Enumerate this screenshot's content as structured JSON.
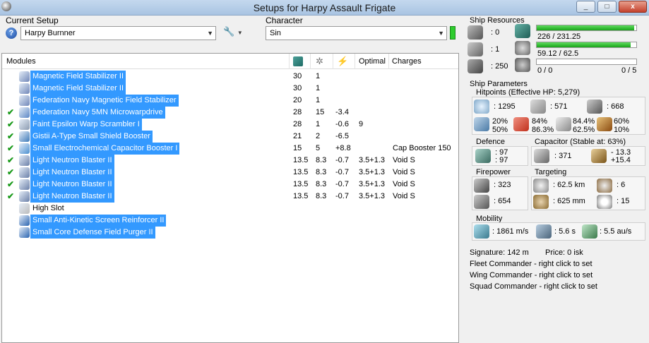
{
  "window": {
    "title": "Setups for Harpy Assault Frigate",
    "min": "_",
    "max": "□",
    "close": "x"
  },
  "setup": {
    "label": "Current Setup",
    "value": "Harpy Burnner",
    "help": "?"
  },
  "character": {
    "label": "Character",
    "value": "Sin"
  },
  "modules": {
    "headers": {
      "name": "Modules",
      "optimal": "Optimal",
      "charges": "Charges"
    },
    "rows": [
      {
        "check": "",
        "name": "Magnetic Field Stabilizer II",
        "cpu": "30",
        "pg": "1",
        "cap": "",
        "optimal": "",
        "charge": "",
        "sel": true,
        "icon": "#6f86b8"
      },
      {
        "check": "",
        "name": "Magnetic Field Stabilizer II",
        "cpu": "30",
        "pg": "1",
        "cap": "",
        "optimal": "",
        "charge": "",
        "sel": true,
        "icon": "#6f86b8"
      },
      {
        "check": "",
        "name": "Federation Navy Magnetic Field Stabilizer",
        "cpu": "20",
        "pg": "1",
        "cap": "",
        "optimal": "",
        "charge": "",
        "sel": true,
        "icon": "#6f86b8"
      },
      {
        "check": "✔",
        "name": "Federation Navy 5MN Microwarpdrive",
        "cpu": "28",
        "pg": "15",
        "cap": "-3.4",
        "optimal": "",
        "charge": "",
        "sel": true,
        "icon": "#5b86c4"
      },
      {
        "check": "✔",
        "name": "Faint Epsilon Warp Scrambler I",
        "cpu": "28",
        "pg": "1",
        "cap": "-0.6",
        "optimal": "9",
        "charge": "",
        "sel": true,
        "icon": "#8a9ab0"
      },
      {
        "check": "✔",
        "name": "Gistii A-Type Small Shield Booster",
        "cpu": "21",
        "pg": "2",
        "cap": "-6.5",
        "optimal": "",
        "charge": "",
        "sel": true,
        "icon": "#3d7ab8"
      },
      {
        "check": "✔",
        "name": "Small Electrochemical Capacitor Booster I",
        "cpu": "15",
        "pg": "5",
        "cap": "+8.8",
        "optimal": "",
        "charge": "Cap Booster 150",
        "sel": true,
        "icon": "#4a8fd0"
      },
      {
        "check": "✔",
        "name": "Light Neutron Blaster II",
        "cpu": "13.5",
        "pg": "8.3",
        "cap": "-0.7",
        "optimal": "3.5+1.3",
        "charge": "Void S",
        "sel": true,
        "icon": "#6a7fa8"
      },
      {
        "check": "✔",
        "name": "Light Neutron Blaster II",
        "cpu": "13.5",
        "pg": "8.3",
        "cap": "-0.7",
        "optimal": "3.5+1.3",
        "charge": "Void S",
        "sel": true,
        "icon": "#6a7fa8"
      },
      {
        "check": "✔",
        "name": "Light Neutron Blaster II",
        "cpu": "13.5",
        "pg": "8.3",
        "cap": "-0.7",
        "optimal": "3.5+1.3",
        "charge": "Void S",
        "sel": true,
        "icon": "#6a7fa8"
      },
      {
        "check": "✔",
        "name": "Light Neutron Blaster II",
        "cpu": "13.5",
        "pg": "8.3",
        "cap": "-0.7",
        "optimal": "3.5+1.3",
        "charge": "Void S",
        "sel": true,
        "icon": "#6a7fa8"
      },
      {
        "check": "",
        "name": "High Slot",
        "cpu": "",
        "pg": "",
        "cap": "",
        "optimal": "",
        "charge": "",
        "sel": false,
        "icon": "#bbbbbb"
      },
      {
        "check": "",
        "name": "Small Anti-Kinetic Screen Reinforcer II",
        "cpu": "",
        "pg": "",
        "cap": "",
        "optimal": "",
        "charge": "",
        "sel": true,
        "icon": "#2a64b0"
      },
      {
        "check": "",
        "name": "Small Core Defense Field Purger II",
        "cpu": "",
        "pg": "",
        "cap": "",
        "optimal": "",
        "charge": "",
        "sel": true,
        "icon": "#2a64b0"
      }
    ]
  },
  "resources": {
    "label": "Ship Resources",
    "turret_slots": ": 0",
    "launcher_slots": ": 1",
    "drone_bay": ": 250",
    "cpu": "226 / 231.25",
    "cpu_fraction": 0.977,
    "powergrid": "59.12 / 62.5",
    "powergrid_fraction": 0.946,
    "drones": "0 / 0",
    "drones_active": "0 / 5"
  },
  "params": {
    "label": "Ship Parameters",
    "hitpoints_label": "Hitpoints (Effective HP: 5,279)",
    "shield_hp": ": 1295",
    "armor_hp": ": 571",
    "structure_hp": ": 668",
    "shield_res_a": "20%",
    "shield_res_b": "50%",
    "armor_res_a": "84%",
    "armor_res_b": "86.3%",
    "kin_res_a": "84.4%",
    "kin_res_b": "62.5%",
    "exp_res_a": "60%",
    "exp_res_b": "10%",
    "defence_label": "Defence",
    "defence_a": ": 97",
    "defence_b": ": 97",
    "capacitor_label": "Capacitor (Stable at: 63%)",
    "cap_amount": ": 371",
    "cap_delta_a": "- 13.3",
    "cap_delta_b": "+15.4",
    "firepower_label": "Firepower",
    "fire_a": ": 323",
    "fire_b": ": 654",
    "targeting_label": "Targeting",
    "target_range": ": 62.5 km",
    "target_count": ": 6",
    "scan_res": ": 625 mm",
    "sensor_strength": ": 15",
    "mobility_label": "Mobility",
    "speed": ": 1861 m/s",
    "align": ": 5.6 s",
    "warp": ": 5.5 au/s"
  },
  "info": {
    "signature": "Signature: 142 m",
    "price": "Price: 0 isk",
    "fleet": "Fleet Commander - right click to set",
    "wing": "Wing Commander - right click to set",
    "squad": "Squad Commander - right click to set"
  }
}
